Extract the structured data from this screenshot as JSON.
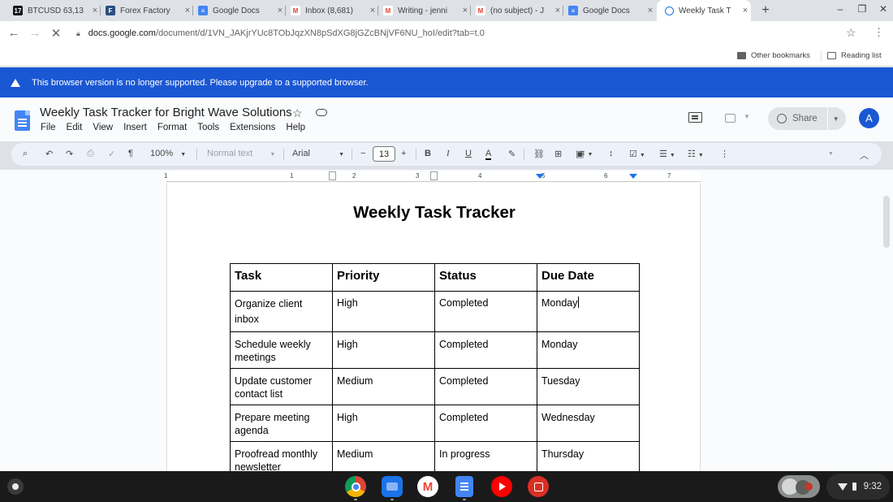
{
  "browser": {
    "tabs": [
      {
        "title": "BTCUSD 63,13",
        "icon": "tradingview-icon",
        "color": "#131722",
        "glyph": "17"
      },
      {
        "title": "Forex Factory",
        "icon": "forex-factory-icon",
        "color": "#2a4f80",
        "glyph": "F"
      },
      {
        "title": "Google Docs",
        "icon": "google-docs-icon",
        "color": "#4285f4",
        "glyph": "≡"
      },
      {
        "title": "Inbox (8,681)",
        "icon": "gmail-icon",
        "color": "#ea4335",
        "glyph": "M"
      },
      {
        "title": "Writing - jenni",
        "icon": "gmail-icon",
        "color": "#ea4335",
        "glyph": "M"
      },
      {
        "title": "(no subject) - J",
        "icon": "gmail-icon",
        "color": "#ea4335",
        "glyph": "M"
      },
      {
        "title": "Google Docs",
        "icon": "google-docs-icon",
        "color": "#4285f4",
        "glyph": "≡"
      },
      {
        "title": "Weekly Task T",
        "icon": "loading-icon",
        "color": "#1a73e8",
        "glyph": "◌"
      }
    ],
    "url_host": "docs.google.com",
    "url_path": "/document/d/1VN_JAKjrYUc8TObJqzXN8pSdXG8jGZcBNjVF6NU_hoI/edit?tab=t.0",
    "bookmarks": {
      "other": "Other bookmarks",
      "reading": "Reading list"
    }
  },
  "banner": {
    "text": "This browser version is no longer supported. Please upgrade to a supported browser."
  },
  "docs": {
    "title": "Weekly Task Tracker for Bright Wave Solutions",
    "menu": [
      "File",
      "Edit",
      "View",
      "Insert",
      "Format",
      "Tools",
      "Extensions",
      "Help"
    ],
    "share_label": "Share",
    "avatar_letter": "A",
    "toolbar": {
      "zoom": "100%",
      "style": "Normal text",
      "font": "Arial",
      "font_size": "13"
    },
    "ruler_numbers": [
      "1",
      "1",
      "2",
      "3",
      "4",
      "5",
      "6",
      "7"
    ]
  },
  "document": {
    "heading": "Weekly Task Tracker",
    "table": {
      "headers": [
        "Task",
        "Priority",
        "Status",
        "Due Date"
      ],
      "rows": [
        [
          "Organize client inbox",
          "High",
          "Completed",
          "Monday"
        ],
        [
          "Schedule weekly meetings",
          "High",
          "Completed",
          "Monday"
        ],
        [
          "Update customer contact list",
          "Medium",
          "Completed",
          "Tuesday"
        ],
        [
          "Prepare meeting agenda",
          "High",
          "Completed",
          "Wednesday"
        ],
        [
          "Proofread monthly newsletter",
          "Medium",
          "In progress",
          "Thursday"
        ]
      ]
    }
  },
  "shelf": {
    "apps": [
      {
        "name": "chrome-icon",
        "color": "#db4437"
      },
      {
        "name": "files-icon",
        "color": "#1a73e8"
      },
      {
        "name": "gmail-icon",
        "color": "#ffffff"
      },
      {
        "name": "docs-icon",
        "color": "#4285f4"
      },
      {
        "name": "youtube-icon",
        "color": "#ff0000"
      },
      {
        "name": "gallery-icon",
        "color": "#d93025"
      }
    ],
    "time": "9:32"
  }
}
